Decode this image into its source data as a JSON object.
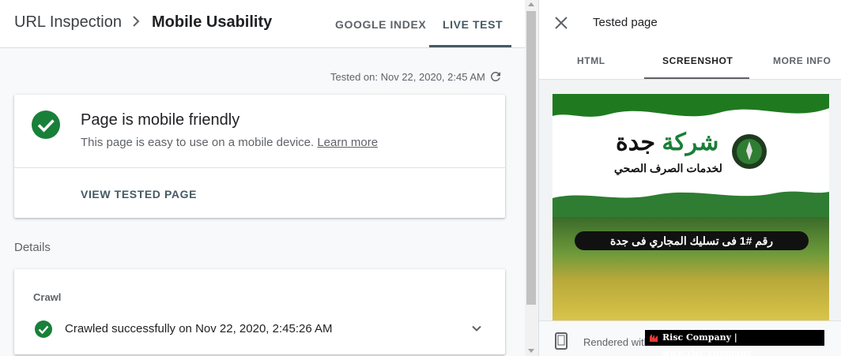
{
  "breadcrumb": {
    "root": "URL Inspection",
    "current": "Mobile Usability"
  },
  "tabs": {
    "google_index": "GOOGLE INDEX",
    "live_test": "LIVE TEST"
  },
  "tested_on": "Tested on: Nov 22, 2020, 2:45 AM",
  "status": {
    "title": "Page is mobile friendly",
    "subtitle": "This page is easy to use on a mobile device.",
    "learn_more": "Learn more",
    "view_button": "VIEW TESTED PAGE"
  },
  "details": {
    "label": "Details",
    "crawl_heading": "Crawl",
    "crawl_result": "Crawled successfully on Nov 22, 2020, 2:45:26 AM"
  },
  "panel": {
    "title": "Tested page",
    "tabs": {
      "html": "HTML",
      "screenshot": "SCREENSHOT",
      "more_info": "MORE INFO"
    },
    "footer_text": "Rendered with"
  },
  "preview_site": {
    "name_green": "شركة",
    "name_dark": "جدة",
    "tagline": "لخدمات الصرف الصحي",
    "banner": "رقم #1 فى تسليك المجاري فى جدة"
  },
  "watermark": "Risc Company | www.risc.company",
  "colors": {
    "success_green": "#188038",
    "brand_green": "#1a7f37",
    "accent_tab": "#455a64"
  },
  "icons": {
    "breadcrumb_separator": "chevron-right-icon",
    "refresh": "refresh-icon",
    "success": "check-circle-icon",
    "expand": "chevron-down-icon",
    "close": "close-icon",
    "device": "smartphone-icon"
  }
}
